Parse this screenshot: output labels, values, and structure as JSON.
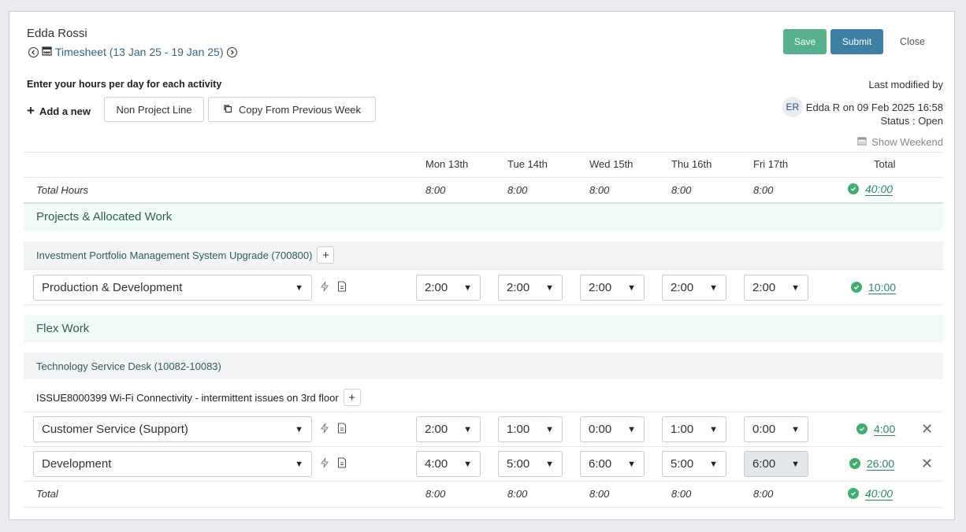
{
  "header": {
    "employee_name": "Edda Rossi",
    "timesheet_label": "Timesheet (13 Jan 25 - 19 Jan 25)",
    "save_label": "Save",
    "submit_label": "Submit",
    "close_label": "Close"
  },
  "toolbar": {
    "instruction": "Enter your hours per day for each activity",
    "add_new_label": "Add a new",
    "non_project_label": "Non Project Line",
    "copy_prev_label": "Copy From Previous Week"
  },
  "meta": {
    "last_modified_label": "Last modified by",
    "avatar_initials": "ER",
    "modified_text": "Edda R on 09 Feb 2025 16:58",
    "status_text": "Status : Open",
    "show_weekend_label": "Show Weekend"
  },
  "days": [
    "Mon 13th",
    "Tue 14th",
    "Wed 15th",
    "Thu 16th",
    "Fri 17th"
  ],
  "total_col_label": "Total",
  "total_hours": {
    "label": "Total Hours",
    "values": [
      "8:00",
      "8:00",
      "8:00",
      "8:00",
      "8:00"
    ],
    "total": "40:00"
  },
  "sections": {
    "projects": {
      "title": "Projects & Allocated Work",
      "project_name": "Investment Portfolio Management System Upgrade (700800)",
      "rows": [
        {
          "activity": "Production & Development",
          "hours": [
            "2:00",
            "2:00",
            "2:00",
            "2:00",
            "2:00"
          ],
          "total": "10:00"
        }
      ]
    },
    "flex": {
      "title": "Flex Work",
      "project_name": "Technology Service Desk (10082-10083)",
      "issue_name": "ISSUE8000399 Wi-Fi Connectivity - intermittent issues on 3rd floor",
      "rows": [
        {
          "activity": "Customer Service (Support)",
          "hours": [
            "2:00",
            "1:00",
            "0:00",
            "1:00",
            "0:00"
          ],
          "total": "4:00"
        },
        {
          "activity": "Development",
          "hours": [
            "4:00",
            "5:00",
            "6:00",
            "5:00",
            "6:00"
          ],
          "total": "26:00"
        }
      ]
    }
  },
  "footer_total": {
    "label": "Total",
    "values": [
      "8:00",
      "8:00",
      "8:00",
      "8:00",
      "8:00"
    ],
    "total": "40:00"
  },
  "colors": {
    "save": "#55b08b",
    "submit": "#3e7fa6",
    "ok_check": "#3fae70",
    "section_band": "#f0faf7"
  }
}
